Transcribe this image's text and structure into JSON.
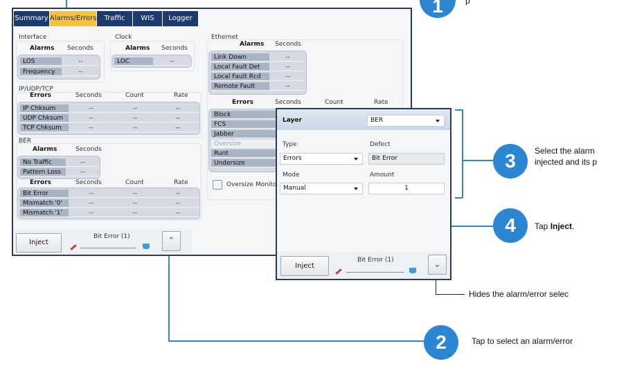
{
  "tabs": [
    "Summary",
    "Alarms/Errors",
    "Traffic",
    "WIS",
    "Logger"
  ],
  "interface": {
    "title": "Interface",
    "col_alarms": "Alarms",
    "col_seconds": "Seconds",
    "rows": [
      {
        "label": "LOS",
        "seconds": "--"
      },
      {
        "label": "Frequency",
        "seconds": "--"
      }
    ]
  },
  "clock": {
    "title": "Clock",
    "col_alarms": "Alarms",
    "col_seconds": "Seconds",
    "rows": [
      {
        "label": "LOC",
        "seconds": "--"
      }
    ]
  },
  "ethernet": {
    "title": "Ethernet",
    "col_alarms": "Alarms",
    "col_seconds": "Seconds",
    "alarm_rows": [
      {
        "label": "Link Down",
        "seconds": "--"
      },
      {
        "label": "Local Fault Det",
        "seconds": "--"
      },
      {
        "label": "Local Fault Rcd",
        "seconds": "--"
      },
      {
        "label": "Remote Fault",
        "seconds": "--"
      }
    ],
    "col_errors": "Errors",
    "col_err_seconds": "Seconds",
    "col_count": "Count",
    "col_rate": "Rate",
    "error_rows": [
      "Block",
      "FCS",
      "Jabber",
      "Oversize",
      "Runt",
      "Undersize"
    ],
    "oversize_monitor": "Oversize Monito"
  },
  "ip": {
    "title": "IP/UDP/TCP",
    "col_errors": "Errors",
    "col_seconds": "Seconds",
    "col_count": "Count",
    "col_rate": "Rate",
    "rows": [
      {
        "label": "IP Chksum",
        "seconds": "--",
        "count": "--",
        "rate": "--"
      },
      {
        "label": "UDP Chksum",
        "seconds": "--",
        "count": "--",
        "rate": "--"
      },
      {
        "label": "TCP Chksum",
        "seconds": "--",
        "count": "--",
        "rate": "--"
      }
    ]
  },
  "ber": {
    "title": "BER",
    "col_alarms": "Alarms",
    "col_seconds": "Seconds",
    "alarm_rows": [
      {
        "label": "No Traffic",
        "seconds": "--"
      },
      {
        "label": "Pattern Loss",
        "seconds": "--"
      }
    ],
    "col_errors": "Errors",
    "col_err_seconds": "Seconds",
    "col_count": "Count",
    "col_rate": "Rate",
    "error_rows": [
      {
        "label": "Bit Error",
        "seconds": "--",
        "count": "--",
        "rate": "--"
      },
      {
        "label": "Mismatch '0'",
        "seconds": "--",
        "count": "--",
        "rate": "--"
      },
      {
        "label": "Mismatch '1'",
        "seconds": "--",
        "count": "--",
        "rate": "--"
      }
    ]
  },
  "bottom": {
    "inject": "Inject",
    "selection": "Bit Error (1)"
  },
  "panel": {
    "layer_label": "Layer",
    "layer_value": "BER",
    "type_label": "Type",
    "type_value": "Errors",
    "defect_label": "Defect",
    "defect_value": "Bit Error",
    "mode_label": "Mode",
    "mode_value": "Manual",
    "amount_label": "Amount",
    "amount_value": "1",
    "inject": "Inject",
    "selection": "Bit Error (1)"
  },
  "callouts": {
    "c1": {
      "num": "1",
      "text": "p"
    },
    "c2": {
      "num": "2",
      "text": "Tap to select an alarm/error"
    },
    "c3": {
      "num": "3",
      "line1": "Select the alarm",
      "line2": "injected and its p"
    },
    "c4": {
      "num": "4",
      "prefix": "Tap ",
      "bold": "Inject",
      "suffix": "."
    },
    "c5": {
      "text": "Hides the alarm/error selec"
    }
  },
  "colors": {
    "accent": "#2c86d1",
    "tab_active": "#f5c342",
    "tab_bg": "#1c3a6e"
  }
}
